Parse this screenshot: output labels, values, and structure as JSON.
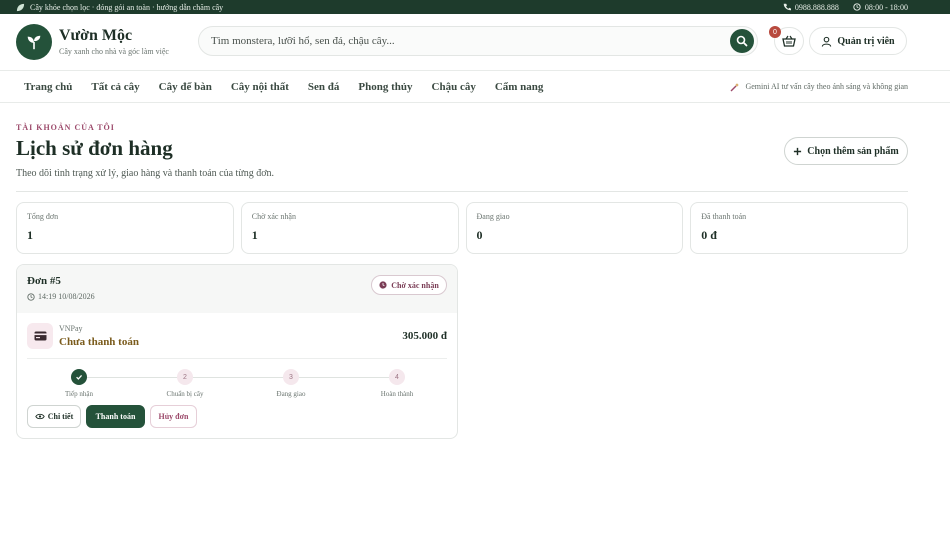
{
  "topbar": {
    "tagline": "Cây khỏe chọn lọc · đóng gói an toàn · hướng dẫn chăm cây",
    "phone": "0988.888.888",
    "hours": "08:00 - 18:00"
  },
  "header": {
    "brand_name": "Vườn Mộc",
    "brand_sub": "Cây xanh cho nhà và góc làm việc",
    "search_placeholder": "Tìm monstera, lưỡi hổ, sen đá, chậu cây...",
    "cart_count": "0",
    "admin_label": "Quản trị viên"
  },
  "nav": {
    "items": [
      {
        "label": "Trang chủ"
      },
      {
        "label": "Tất cả cây"
      },
      {
        "label": "Cây để bàn"
      },
      {
        "label": "Cây nội thất"
      },
      {
        "label": "Sen đá"
      },
      {
        "label": "Phong thủy"
      },
      {
        "label": "Chậu cây"
      },
      {
        "label": "Cẩm nang"
      }
    ],
    "ai_hint": "Gemini AI tư vấn cây theo ánh sáng và không gian"
  },
  "page": {
    "eyebrow": "TÀI KHOẢN CỦA TÔI",
    "title": "Lịch sử đơn hàng",
    "description": "Theo dõi tình trạng xử lý, giao hàng và thanh toán của từng đơn.",
    "choose_more_label": "Chọn thêm sản phẩm"
  },
  "stats": [
    {
      "label": "Tổng đơn",
      "value": "1"
    },
    {
      "label": "Chờ xác nhận",
      "value": "1"
    },
    {
      "label": "Đang giao",
      "value": "0"
    },
    {
      "label": "Đã thanh toán",
      "value": "0 đ"
    }
  ],
  "order": {
    "id": "Đơn #5",
    "time": "14:19 10/08/2026",
    "status": "Chờ xác nhận",
    "payment_method": "VNPay",
    "payment_status": "Chưa thanh toán",
    "amount": "305.000 đ",
    "steps": [
      {
        "num": "1",
        "label": "Tiếp nhận",
        "done": true
      },
      {
        "num": "2",
        "label": "Chuẩn bị cây",
        "done": false
      },
      {
        "num": "3",
        "label": "Đang giao",
        "done": false
      },
      {
        "num": "4",
        "label": "Hoàn thành",
        "done": false
      }
    ],
    "actions": {
      "detail": "Chi tiết",
      "pay": "Thanh toán",
      "cancel": "Hủy đơn"
    }
  },
  "colors": {
    "primary": "#24523a",
    "topbar": "#1e3b2c",
    "accent": "#9c4a6b",
    "pay_pending": "#7a5b1c"
  }
}
